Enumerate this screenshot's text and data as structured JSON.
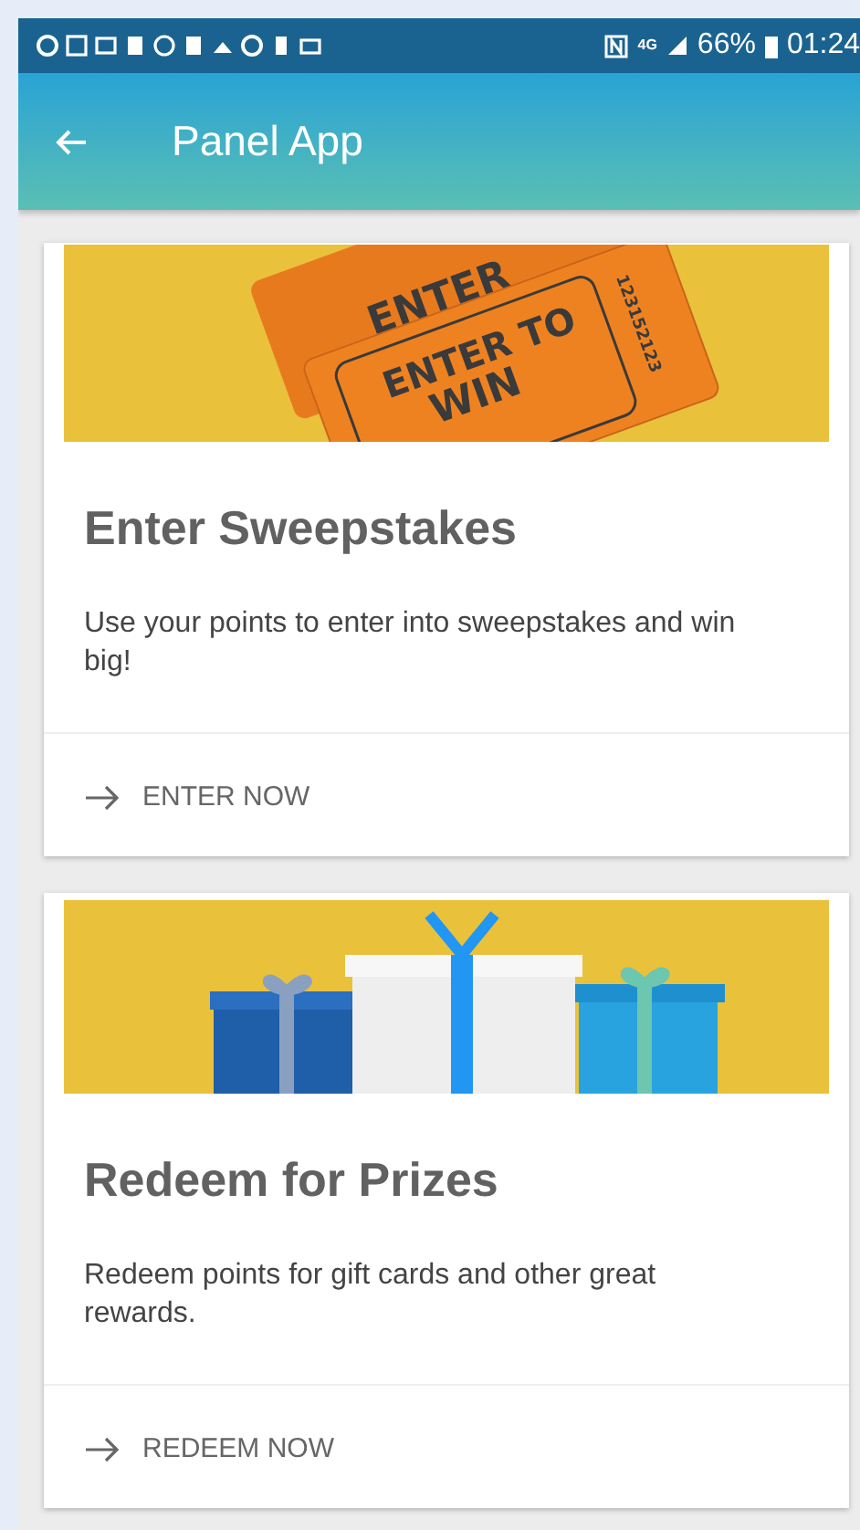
{
  "status_bar": {
    "network": "4G",
    "battery": "66%",
    "time": "01:24"
  },
  "app_bar": {
    "title": "Panel App"
  },
  "cards": [
    {
      "kind": "tickets",
      "title": "Enter Sweepstakes",
      "description": "Use your points to enter into sweepstakes and win big!",
      "action": "ENTER NOW",
      "art_texts": [
        "ENTER",
        "ENTER TO",
        "WIN",
        "123152123"
      ]
    },
    {
      "kind": "gifts",
      "title": "Redeem for Prizes",
      "description": "Redeem points for gift cards and other great rewards.",
      "action": "REDEEM NOW"
    }
  ]
}
